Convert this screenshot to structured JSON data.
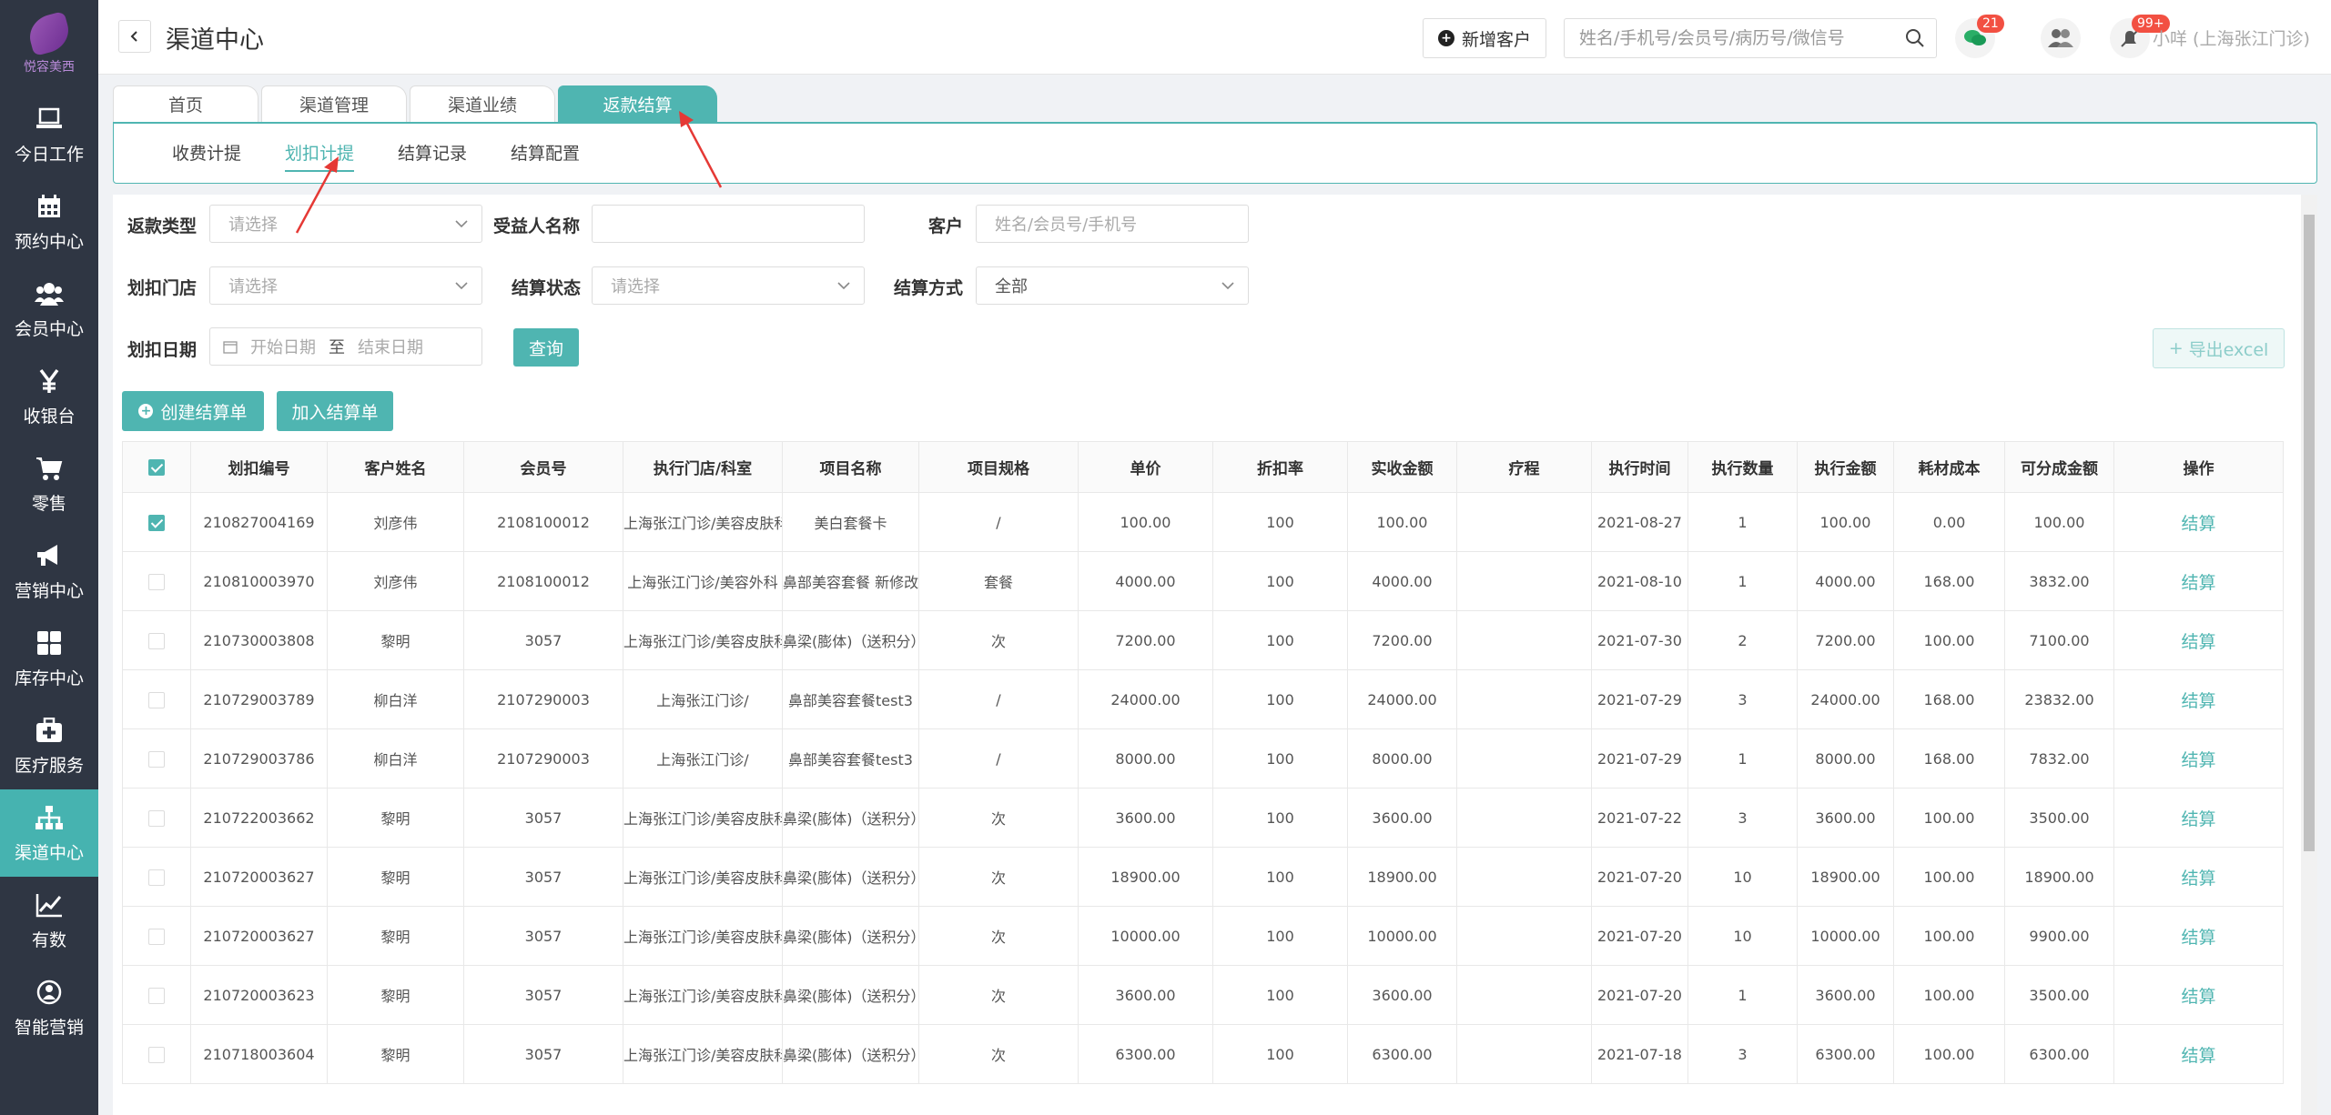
{
  "app": {
    "logo_text": "悦容美西"
  },
  "sidebar": {
    "items": [
      {
        "label": "今日工作",
        "icon": "laptop-icon"
      },
      {
        "label": "预约中心",
        "icon": "calendar-icon"
      },
      {
        "label": "会员中心",
        "icon": "users-icon"
      },
      {
        "label": "收银台",
        "icon": "yen-icon"
      },
      {
        "label": "零售",
        "icon": "cart-icon"
      },
      {
        "label": "营销中心",
        "icon": "megaphone-icon"
      },
      {
        "label": "库存中心",
        "icon": "grid-icon"
      },
      {
        "label": "医疗服务",
        "icon": "medkit-icon"
      },
      {
        "label": "渠道中心",
        "icon": "sitemap-icon",
        "active": true
      },
      {
        "label": "有数",
        "icon": "chart-line-icon"
      },
      {
        "label": "智能营销",
        "icon": "robot-icon"
      }
    ]
  },
  "header": {
    "title": "渠道中心",
    "new_customer_label": "新增客户",
    "search_placeholder": "姓名/手机号/会员号/病历号/微信号",
    "chat_badge": "21",
    "notify_badge": "99+",
    "user": "小咩 (上海张江门诊)"
  },
  "tabs": [
    {
      "label": "首页"
    },
    {
      "label": "渠道管理"
    },
    {
      "label": "渠道业绩"
    },
    {
      "label": "返款结算",
      "active": true
    }
  ],
  "subtabs": [
    {
      "label": "收费计提"
    },
    {
      "label": "划扣计提",
      "active": true
    },
    {
      "label": "结算记录"
    },
    {
      "label": "结算配置"
    }
  ],
  "filters": {
    "refund_type": {
      "label": "返款类型",
      "placeholder": "请选择"
    },
    "beneficiary": {
      "label": "受益人名称",
      "value": ""
    },
    "customer": {
      "label": "客户",
      "placeholder": "姓名/会员号/手机号"
    },
    "store": {
      "label": "划扣门店",
      "placeholder": "请选择"
    },
    "status": {
      "label": "结算状态",
      "placeholder": "请选择"
    },
    "method": {
      "label": "结算方式",
      "value": "全部"
    },
    "date": {
      "label": "划扣日期",
      "start_placeholder": "开始日期",
      "sep": "至",
      "end_placeholder": "结束日期"
    },
    "query_label": "查询",
    "export_label": "导出excel"
  },
  "actions": {
    "create_label": "创建结算单",
    "join_label": "加入结算单"
  },
  "table": {
    "columns": [
      "划扣编号",
      "客户姓名",
      "会员号",
      "执行门店/科室",
      "项目名称",
      "项目规格",
      "单价",
      "折扣率",
      "实收金额",
      "疗程",
      "执行时间",
      "执行数量",
      "执行金额",
      "耗材成本",
      "可分成金额",
      "操作"
    ],
    "rows": [
      {
        "checked": true,
        "cells": [
          "210827004169",
          "刘彦伟",
          "2108100012",
          "上海张江门诊/美容皮肤科",
          "美白套餐卡",
          "/",
          "100.00",
          "100",
          "100.00",
          "",
          "2021-08-27",
          "1",
          "100.00",
          "0.00",
          "100.00"
        ],
        "action": "结算"
      },
      {
        "checked": false,
        "cells": [
          "210810003970",
          "刘彦伟",
          "2108100012",
          "上海张江门诊/美容外科",
          "鼻部美容套餐 新修改",
          "套餐",
          "4000.00",
          "100",
          "4000.00",
          "",
          "2021-08-10",
          "1",
          "4000.00",
          "168.00",
          "3832.00"
        ],
        "action": "结算"
      },
      {
        "checked": false,
        "cells": [
          "210730003808",
          "黎明",
          "3057",
          "上海张江门诊/美容皮肤科",
          "鼻梁(膨体)（送积分）",
          "次",
          "7200.00",
          "100",
          "7200.00",
          "",
          "2021-07-30",
          "2",
          "7200.00",
          "100.00",
          "7100.00"
        ],
        "action": "结算"
      },
      {
        "checked": false,
        "cells": [
          "210729003789",
          "柳白洋",
          "2107290003",
          "上海张江门诊/",
          "鼻部美容套餐test3",
          "/",
          "24000.00",
          "100",
          "24000.00",
          "",
          "2021-07-29",
          "3",
          "24000.00",
          "168.00",
          "23832.00"
        ],
        "action": "结算"
      },
      {
        "checked": false,
        "cells": [
          "210729003786",
          "柳白洋",
          "2107290003",
          "上海张江门诊/",
          "鼻部美容套餐test3",
          "/",
          "8000.00",
          "100",
          "8000.00",
          "",
          "2021-07-29",
          "1",
          "8000.00",
          "168.00",
          "7832.00"
        ],
        "action": "结算"
      },
      {
        "checked": false,
        "cells": [
          "210722003662",
          "黎明",
          "3057",
          "上海张江门诊/美容皮肤科",
          "鼻梁(膨体)（送积分）",
          "次",
          "3600.00",
          "100",
          "3600.00",
          "",
          "2021-07-22",
          "3",
          "3600.00",
          "100.00",
          "3500.00"
        ],
        "action": "结算"
      },
      {
        "checked": false,
        "cells": [
          "210720003627",
          "黎明",
          "3057",
          "上海张江门诊/美容皮肤科",
          "鼻梁(膨体)（送积分）",
          "次",
          "18900.00",
          "100",
          "18900.00",
          "",
          "2021-07-20",
          "10",
          "18900.00",
          "100.00",
          "18900.00"
        ],
        "action": "结算"
      },
      {
        "checked": false,
        "cells": [
          "210720003627",
          "黎明",
          "3057",
          "上海张江门诊/美容皮肤科",
          "鼻梁(膨体)（送积分）",
          "次",
          "10000.00",
          "100",
          "10000.00",
          "",
          "2021-07-20",
          "10",
          "10000.00",
          "100.00",
          "9900.00"
        ],
        "action": "结算"
      },
      {
        "checked": false,
        "cells": [
          "210720003623",
          "黎明",
          "3057",
          "上海张江门诊/美容皮肤科",
          "鼻梁(膨体)（送积分）",
          "次",
          "3600.00",
          "100",
          "3600.00",
          "",
          "2021-07-20",
          "1",
          "3600.00",
          "100.00",
          "3500.00"
        ],
        "action": "结算"
      },
      {
        "checked": false,
        "cells": [
          "210718003604",
          "黎明",
          "3057",
          "上海张江门诊/美容皮肤科",
          "鼻梁(膨体)（送积分）",
          "次",
          "6300.00",
          "100",
          "6300.00",
          "",
          "2021-07-18",
          "3",
          "6300.00",
          "100.00",
          "6300.00"
        ],
        "action": "结算"
      }
    ]
  }
}
